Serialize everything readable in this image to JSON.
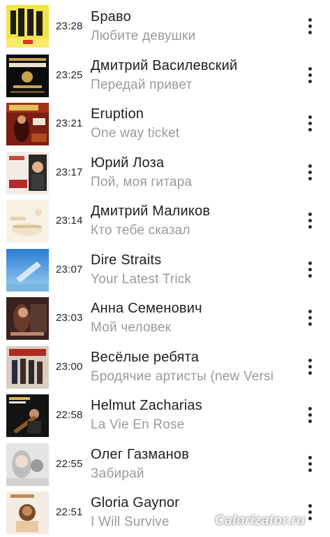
{
  "tracks": [
    {
      "time": "23:28",
      "artist": "Браво",
      "song": "Любите девушки",
      "cover_colors": [
        "#f2e24a",
        "#1c1c1c"
      ]
    },
    {
      "time": "23:25",
      "artist": "Дмитрий Василевский",
      "song": "Передай привет",
      "cover_colors": [
        "#0c0c0c",
        "#c9a34a"
      ]
    },
    {
      "time": "23:21",
      "artist": "Eruption",
      "song": "One way ticket",
      "cover_colors": [
        "#7a1f12",
        "#e2c15a"
      ]
    },
    {
      "time": "23:17",
      "artist": "Юрий Лоза",
      "song": "Пой, моя гитара",
      "cover_colors": [
        "#f3ece6",
        "#b52a2a"
      ]
    },
    {
      "time": "23:14",
      "artist": "Дмитрий Маликов",
      "song": "Кто тебе сказал",
      "cover_colors": [
        "#f7f1e6",
        "#e6d2b2"
      ]
    },
    {
      "time": "23:07",
      "artist": "Dire Straits",
      "song": "Your Latest Trick",
      "cover_colors": [
        "#3a86d6",
        "#9fd2f2"
      ]
    },
    {
      "time": "23:03",
      "artist": "Анна Семенович",
      "song": "Мой человек",
      "cover_colors": [
        "#3a2220",
        "#b9876a"
      ]
    },
    {
      "time": "23:00",
      "artist": "Весёлые ребята",
      "song": "Бродячие артисты (new Versi",
      "cover_colors": [
        "#d6cfc0",
        "#b22a22"
      ]
    },
    {
      "time": "22:58",
      "artist": "Helmut Zacharias",
      "song": "La Vie En Rose",
      "cover_colors": [
        "#141414",
        "#d8b84a"
      ]
    },
    {
      "time": "22:55",
      "artist": "Олег Газманов",
      "song": "Забирай",
      "cover_colors": [
        "#e4e4e4",
        "#6a6a6a"
      ]
    },
    {
      "time": "22:51",
      "artist": "Gloria Gaynor",
      "song": "I Will Survive",
      "cover_colors": [
        "#f4ece2",
        "#c08a55"
      ]
    }
  ],
  "watermark": "Calorizator.ru",
  "icons": {
    "more": "more-vertical-icon"
  }
}
